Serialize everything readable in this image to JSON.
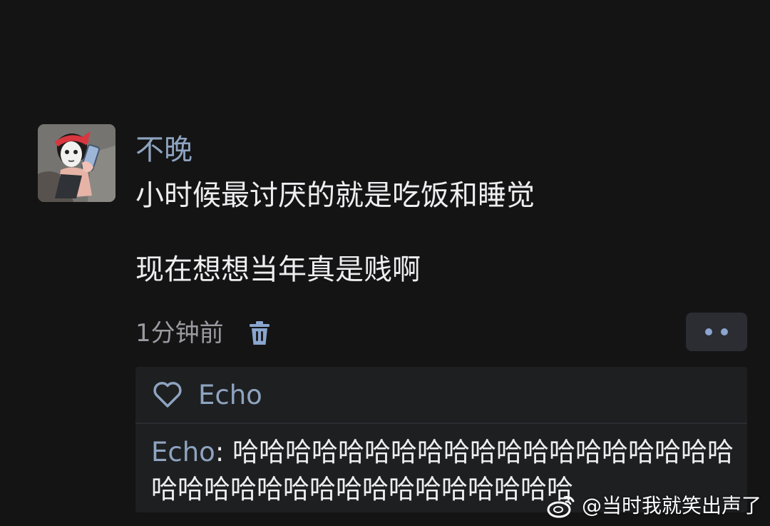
{
  "post": {
    "username": "不晚",
    "content": "小时候最讨厌的就是吃饭和睡觉\n\n现在想想当年真是贱啊",
    "time": "1分钟前",
    "icons": {
      "avatar": "cartoon-woman-face-mask-avatar",
      "delete": "trash-icon",
      "more": "more-dots-icon",
      "like": "heart-outline-icon"
    }
  },
  "interactions": {
    "likes": [
      "Echo"
    ],
    "comments": [
      {
        "author": "Echo",
        "separator": ": ",
        "text": "哈哈哈哈哈哈哈哈哈哈哈哈哈哈哈哈哈哈哈哈哈哈哈哈哈哈哈哈哈哈哈哈哈哈哈"
      }
    ]
  },
  "watermark": {
    "text": "@当时我就笑出声了",
    "icon": "weibo-logo-icon"
  },
  "colors": {
    "background": "#141415",
    "username": "#8ea4c0",
    "panel": "#1e1f21",
    "accent": "#8aa6cf",
    "meta_text": "#9a9aa0"
  }
}
